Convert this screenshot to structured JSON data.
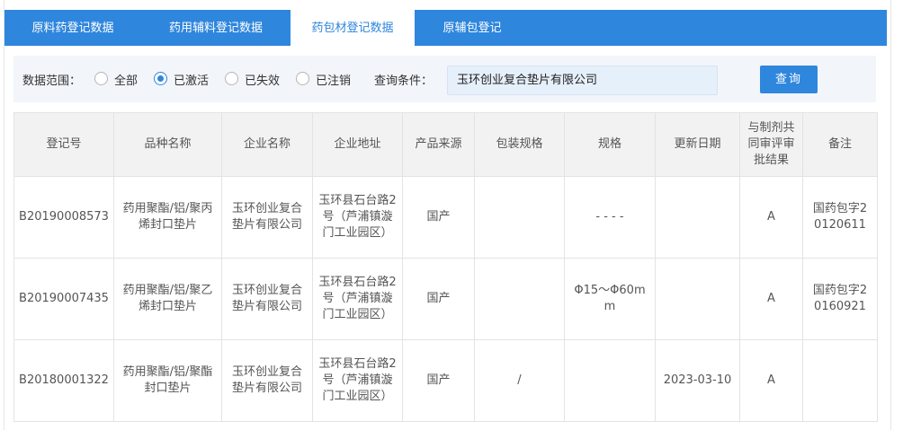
{
  "tabs": [
    {
      "label": "原料药登记数据",
      "active": false
    },
    {
      "label": "药用辅料登记数据",
      "active": false
    },
    {
      "label": "药包材登记数据",
      "active": true
    },
    {
      "label": "原辅包登记",
      "active": false
    }
  ],
  "filter": {
    "scope_label": "数据范围：",
    "options": [
      {
        "label": "全部",
        "checked": false
      },
      {
        "label": "已激活",
        "checked": true
      },
      {
        "label": "已失效",
        "checked": false
      },
      {
        "label": "已注销",
        "checked": false
      }
    ],
    "condition_label": "查询条件：",
    "query_value": "玉环创业复合垫片有限公司",
    "query_button": "查询"
  },
  "table": {
    "headers": [
      "登记号",
      "品种名称",
      "企业名称",
      "企业地址",
      "产品来源",
      "包装规格",
      "规格",
      "更新日期",
      "与制剂共同审评审批结果",
      "备注"
    ],
    "rows": [
      {
        "reg_no": "B20190008573",
        "name": "药用聚酯/铝/聚丙烯封口垫片",
        "company": "玉环创业复合垫片有限公司",
        "address": "玉环县石台路2号（芦浦镇漩门工业园区）",
        "source": "国产",
        "package": "",
        "spec": "- - - -",
        "date": "",
        "result": "A",
        "remark": "国药包字20120611"
      },
      {
        "reg_no": "B20190007435",
        "name": "药用聚酯/铝/聚乙烯封口垫片",
        "company": "玉环创业复合垫片有限公司",
        "address": "玉环县石台路2号（芦浦镇漩门工业园区）",
        "source": "国产",
        "package": "",
        "spec": "Φ15～Φ60mm",
        "date": "",
        "result": "A",
        "remark": "国药包字20160921"
      },
      {
        "reg_no": "B20180001322",
        "name": "药用聚酯/铝/聚酯封口垫片",
        "company": "玉环创业复合垫片有限公司",
        "address": "玉环县石台路2号（芦浦镇漩门工业园区）",
        "source": "国产",
        "package": "/",
        "spec": "",
        "date": "2023-03-10",
        "result": "A",
        "remark": ""
      }
    ]
  }
}
